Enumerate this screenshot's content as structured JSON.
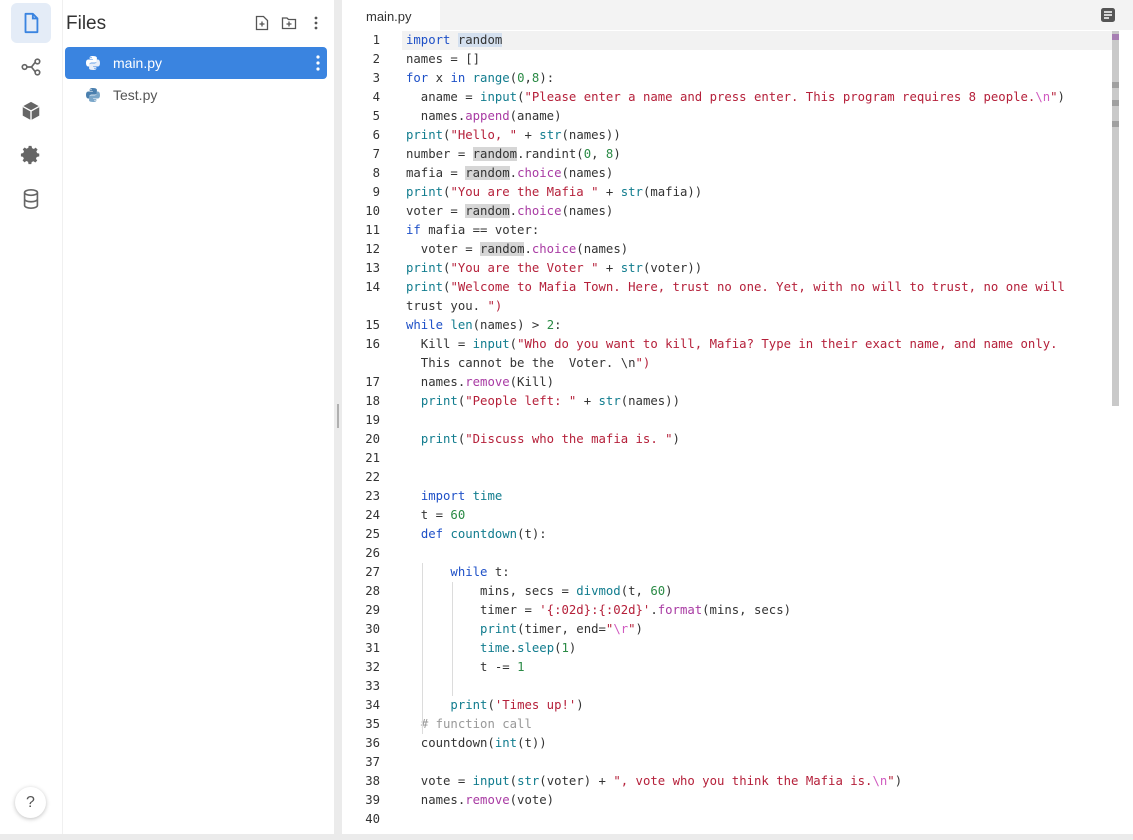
{
  "sidebar": {
    "title": "Files",
    "files": [
      {
        "name": "main.py",
        "selected": true
      },
      {
        "name": "Test.py",
        "selected": false
      }
    ],
    "help_label": "?"
  },
  "editor": {
    "tab_label": "main.py",
    "lines": [
      {
        "n": "1"
      },
      {
        "n": "2"
      },
      {
        "n": "3"
      },
      {
        "n": "4"
      },
      {
        "n": "5"
      },
      {
        "n": "6"
      },
      {
        "n": "7"
      },
      {
        "n": "8"
      },
      {
        "n": "9"
      },
      {
        "n": "10"
      },
      {
        "n": "11"
      },
      {
        "n": "12"
      },
      {
        "n": "13"
      },
      {
        "n": "14"
      },
      {
        "n": "15"
      },
      {
        "n": "16"
      },
      {
        "n": "17"
      },
      {
        "n": "18"
      },
      {
        "n": "19"
      },
      {
        "n": "20"
      },
      {
        "n": "21"
      },
      {
        "n": "22"
      },
      {
        "n": "23"
      },
      {
        "n": "24"
      },
      {
        "n": "25"
      },
      {
        "n": "26"
      },
      {
        "n": "27"
      },
      {
        "n": "28"
      },
      {
        "n": "29"
      },
      {
        "n": "30"
      },
      {
        "n": "31"
      },
      {
        "n": "32"
      },
      {
        "n": "33"
      },
      {
        "n": "34"
      },
      {
        "n": "35"
      },
      {
        "n": "36"
      },
      {
        "n": "37"
      },
      {
        "n": "38"
      },
      {
        "n": "39"
      },
      {
        "n": "40"
      }
    ],
    "code": [
      "import random",
      "names = []",
      "for x in range(0,8):",
      "  aname = input(\"Please enter a name and press enter. This program requires 8 people.\\n\")",
      "  names.append(aname)",
      "print(\"Hello, \" + str(names))",
      "number = random.randint(0, 8)",
      "mafia = random.choice(names)",
      "print(\"You are the Mafia \" + str(mafia))",
      "voter = random.choice(names)",
      "if mafia == voter:",
      "  voter = random.choice(names)",
      "print(\"You are the Voter \" + str(voter))",
      "print(\"Welcome to Mafia Town. Here, trust no one. Yet, with no will to trust, no one will",
      "trust you. \")",
      "while len(names) > 2:",
      "  Kill = input(\"Who do you want to kill, Mafia? Type in their exact name, and name only.",
      "  This cannot be the  Voter. \\n\")",
      "  names.remove(Kill)",
      "  print(\"People left: \" + str(names))",
      "",
      "  print(\"Discuss who the mafia is. \")",
      "",
      "",
      "  import time",
      "  t = 60",
      "  def countdown(t):",
      "",
      "      while t:",
      "          mins, secs = divmod(t, 60)",
      "          timer = '{:02d}:{:02d}'.format(mins, secs)",
      "          print(timer, end=\"\\r\")",
      "          time.sleep(1)",
      "          t -= 1",
      "",
      "      print('Times up!')",
      "  # function call",
      "  countdown(int(t))",
      "",
      "  vote = input(str(voter) + \", vote who you think the Mafia is.\\n\")",
      "  names.remove(vote)",
      ""
    ]
  },
  "colors": {
    "accent": "#3a84e0",
    "keyword": "#1e50c7",
    "builtin": "#117c8e",
    "string": "#b5203a",
    "escape": "#d05ac0",
    "number": "#2a8a45",
    "comment": "#999999"
  },
  "icons": [
    "file-icon",
    "git-icon",
    "package-icon",
    "settings-icon",
    "database-icon",
    "new-file-icon",
    "new-folder-icon",
    "more-icon",
    "python-icon",
    "menu-icon"
  ]
}
